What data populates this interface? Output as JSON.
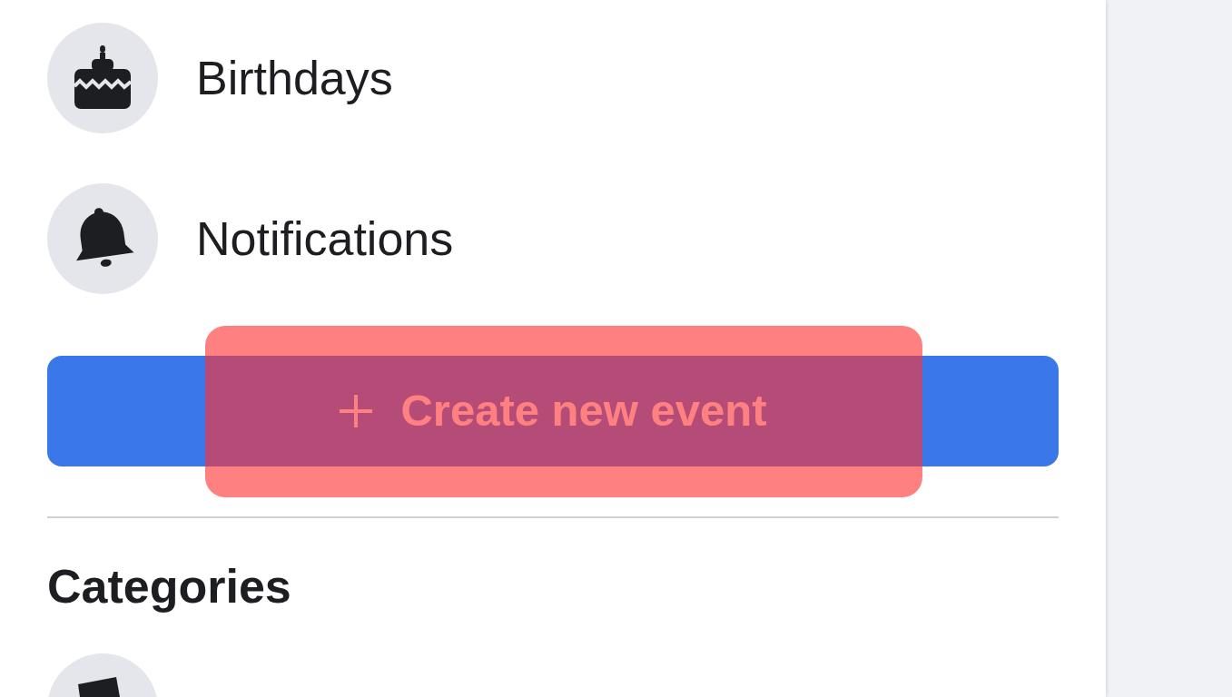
{
  "sidebar": {
    "items": [
      {
        "label": "Birthdays",
        "kind": "birthdays"
      },
      {
        "label": "Notifications",
        "kind": "notifications"
      }
    ],
    "create_event_button": {
      "label": "Create new event",
      "highlighted": true
    },
    "categories": {
      "heading": "Categories"
    }
  }
}
